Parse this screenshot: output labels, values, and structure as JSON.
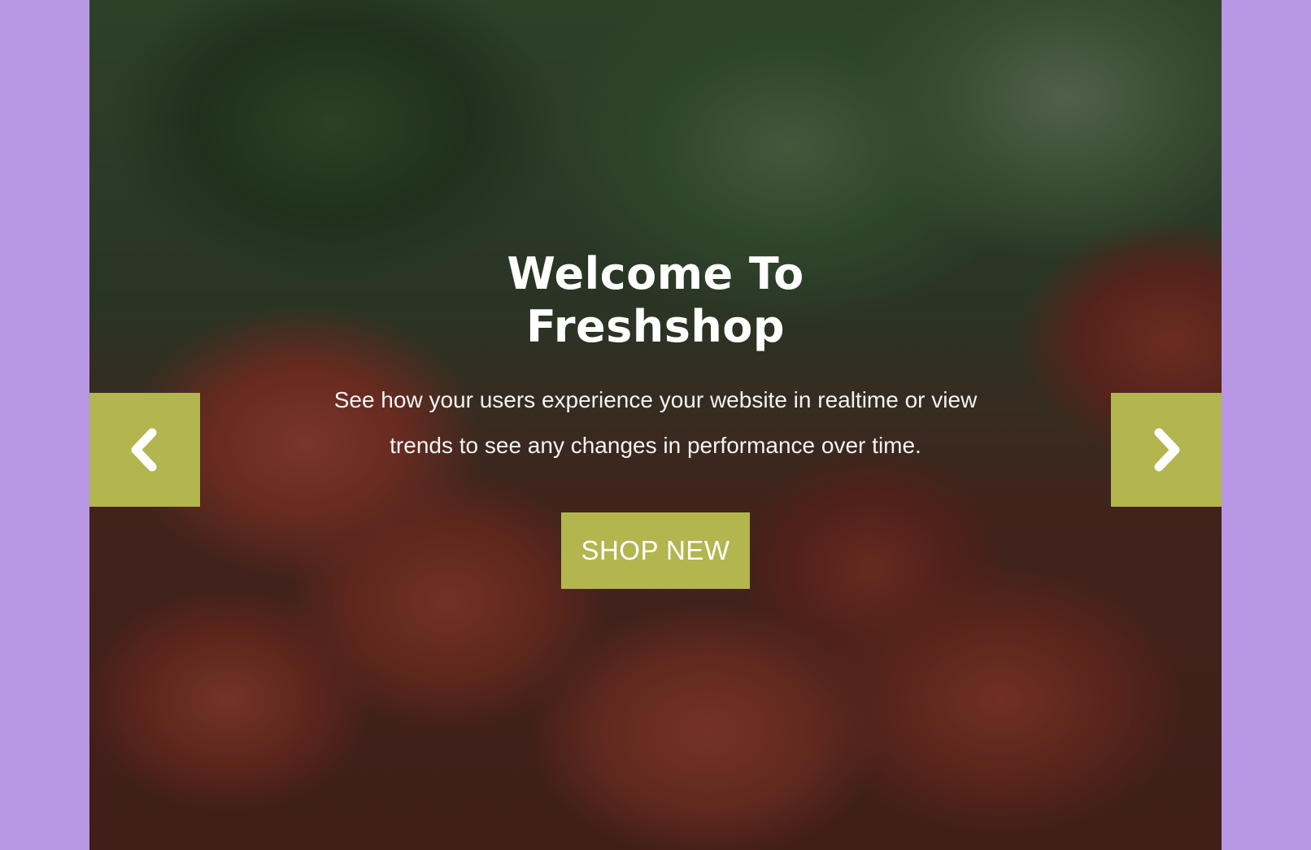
{
  "hero": {
    "title": "Welcome To Freshshop",
    "subtitle": "See how your users experience your website in realtime or view trends to see any changes in performance over time.",
    "cta_label": "SHOP NEW"
  },
  "carousel": {
    "prev_icon": "chevron-left-icon",
    "next_icon": "chevron-right-icon"
  },
  "colors": {
    "page_background": "#b897e4",
    "accent": "#b3b54f",
    "text": "#ffffff"
  }
}
